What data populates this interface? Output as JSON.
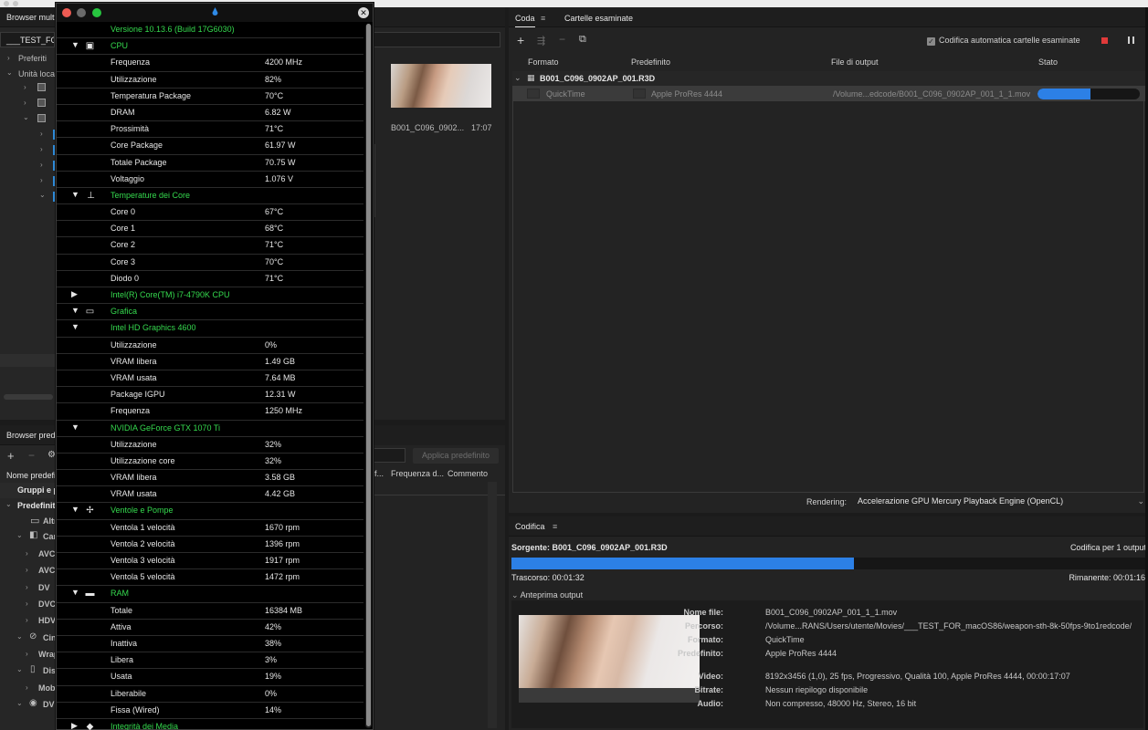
{
  "media_browser": {
    "title": "Browser multimediale",
    "path": "___TEST_FOR",
    "favorites": "Preferiti",
    "local_drives": "Unità locali"
  },
  "preset_browser": {
    "title": "Browser predefiniti",
    "col_name": "Nome predefinito",
    "groups": "Gruppi e predefiniti",
    "system": "Predefiniti di sistema",
    "items": [
      "Altro",
      "Camera",
      "AVC-Intra",
      "AVC-Ultra",
      "DV",
      "DVCPRO",
      "HDV",
      "Cinema",
      "Wraptor",
      "Dispositivi",
      "Mobile",
      "DVD"
    ],
    "apply_button": "Applica predefinito",
    "col_format_short": "f...",
    "col_frequency": "Frequenza d...",
    "col_comment": "Commento"
  },
  "middle": {
    "thumb_name": "B001_C096_0902...",
    "thumb_time": "17:07"
  },
  "queue": {
    "tab_queue": "Coda",
    "tab_watch": "Cartelle esaminate",
    "auto_encode": "Codifica automatica cartelle esaminate",
    "col_format": "Formato",
    "col_preset": "Predefinito",
    "col_output": "File di output",
    "col_status": "Stato",
    "group_name": "B001_C096_0902AP_001.R3D",
    "item": {
      "format": "QuickTime",
      "preset": "Apple ProRes 4444",
      "output": "/Volume...edcode/B001_C096_0902AP_001_1_1.mov",
      "progress": 0.52
    },
    "rendering_label": "Rendering:",
    "rendering_value": "Accelerazione GPU Mercury Playback Engine (OpenCL)"
  },
  "encode": {
    "title": "Codifica",
    "source": "Sorgente: B001_C096_0902AP_001.R3D",
    "for_outputs": "Codifica per 1 output",
    "progress": 0.54,
    "elapsed": "Trascorso: 00:01:32",
    "remaining": "Rimanente: 00:01:16",
    "preview_label": "Anteprima output",
    "meta": [
      {
        "k": "Nome file:",
        "v": "B001_C096_0902AP_001_1_1.mov"
      },
      {
        "k": "Percorso:",
        "v": "/Volume...RANS/Users/utente/Movies/___TEST_FOR_macOS86/weapon-sth-8k-50fps-9to1redcode/"
      },
      {
        "k": "Formato:",
        "v": "QuickTime"
      },
      {
        "k": "Predefinito:",
        "v": "Apple ProRes 4444"
      },
      {
        "k": "Video:",
        "v": "8192x3456 (1,0), 25 fps, Progressivo, Qualità 100, Apple ProRes 4444, 00:00:17:07"
      },
      {
        "k": "Bitrate:",
        "v": "Nessun riepilogo disponibile"
      },
      {
        "k": "Audio:",
        "v": "Non compresso, 48000 Hz, Stereo, 16 bit"
      }
    ]
  },
  "stats": {
    "rows": [
      {
        "type": "section",
        "icon": "apple-icon",
        "glyph": "",
        "label": "Versione 10.13.6 (Build 17G6030)"
      },
      {
        "type": "section",
        "tri": "▼",
        "icon": "cpu-icon",
        "glyph": "▣",
        "label": "CPU"
      },
      {
        "type": "item",
        "label": "Frequenza",
        "value": "4200 MHz"
      },
      {
        "type": "item",
        "label": "Utilizzazione",
        "value": "82%"
      },
      {
        "type": "item",
        "label": "Temperatura Package",
        "value": "70°C"
      },
      {
        "type": "item",
        "label": "DRAM",
        "value": "6.82 W"
      },
      {
        "type": "item",
        "label": "Prossimità",
        "value": "71°C"
      },
      {
        "type": "item",
        "label": "Core Package",
        "value": "61.97 W"
      },
      {
        "type": "item",
        "label": "Totale Package",
        "value": "70.75 W"
      },
      {
        "type": "item",
        "label": "Voltaggio",
        "value": "1.076 V"
      },
      {
        "type": "section",
        "tri": "▼",
        "icon": "thermometer-icon",
        "glyph": "⊥",
        "label": "Temperature dei Core",
        "indent": true
      },
      {
        "type": "item",
        "label": "Core 0",
        "value": "67°C"
      },
      {
        "type": "item",
        "label": "Core 1",
        "value": "68°C"
      },
      {
        "type": "item",
        "label": "Core 2",
        "value": "71°C"
      },
      {
        "type": "item",
        "label": "Core 3",
        "value": "70°C"
      },
      {
        "type": "item",
        "label": "Diodo 0",
        "value": "71°C"
      },
      {
        "type": "section",
        "tri": "▶",
        "label": "Intel(R) Core(TM) i7-4790K CPU",
        "indent": true
      },
      {
        "type": "section",
        "tri": "▼",
        "icon": "gpu-icon",
        "glyph": "▭",
        "label": "Grafica"
      },
      {
        "type": "section",
        "tri": "▼",
        "label": "Intel HD Graphics 4600",
        "indent": true
      },
      {
        "type": "item",
        "label": "Utilizzazione",
        "value": "0%"
      },
      {
        "type": "item",
        "label": "VRAM libera",
        "value": "1.49 GB"
      },
      {
        "type": "item",
        "label": "VRAM usata",
        "value": "7.64 MB"
      },
      {
        "type": "item",
        "label": "Package IGPU",
        "value": "12.31 W"
      },
      {
        "type": "item",
        "label": "Frequenza",
        "value": "1250 MHz"
      },
      {
        "type": "section",
        "tri": "▼",
        "label": "NVIDIA GeForce GTX 1070 Ti",
        "indent": true
      },
      {
        "type": "item",
        "label": "Utilizzazione",
        "value": "32%"
      },
      {
        "type": "item",
        "label": "Utilizzazione core",
        "value": "32%"
      },
      {
        "type": "item",
        "label": "VRAM libera",
        "value": "3.58 GB"
      },
      {
        "type": "item",
        "label": "VRAM usata",
        "value": "4.42 GB"
      },
      {
        "type": "section",
        "tri": "▼",
        "icon": "fan-icon",
        "glyph": "✢",
        "label": "Ventole e Pompe"
      },
      {
        "type": "item",
        "label": "Ventola 1 velocità",
        "value": "1670 rpm"
      },
      {
        "type": "item",
        "label": "Ventola 2 velocità",
        "value": "1396 rpm"
      },
      {
        "type": "item",
        "label": "Ventola 3 velocità",
        "value": "1917 rpm"
      },
      {
        "type": "item",
        "label": "Ventola 5 velocità",
        "value": "1472 rpm"
      },
      {
        "type": "section",
        "tri": "▼",
        "icon": "ram-icon",
        "glyph": "▬",
        "label": "RAM"
      },
      {
        "type": "item",
        "label": "Totale",
        "value": "16384 MB"
      },
      {
        "type": "item",
        "label": "Attiva",
        "value": "42%"
      },
      {
        "type": "item",
        "label": "Inattiva",
        "value": "38%"
      },
      {
        "type": "item",
        "label": "Libera",
        "value": "3%"
      },
      {
        "type": "item",
        "label": "Usata",
        "value": "19%"
      },
      {
        "type": "item",
        "label": "Liberabile",
        "value": "0%"
      },
      {
        "type": "item",
        "label": "Fissa (Wired)",
        "value": "14%"
      },
      {
        "type": "section",
        "tri": "▶",
        "icon": "disk-icon",
        "glyph": "◆",
        "label": "Integrità dei Media"
      }
    ]
  },
  "colors": {
    "accent_green": "#35d94e",
    "progress_blue": "#2c80e6",
    "stop_red": "#e03a3a"
  }
}
